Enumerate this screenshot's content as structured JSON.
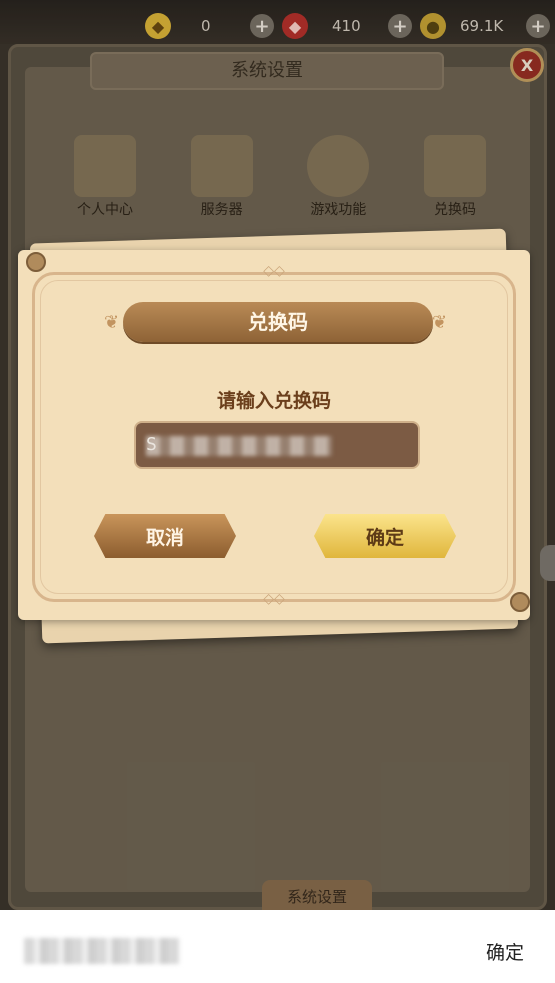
{
  "resources": [
    {
      "icon": "diamond-icon",
      "value": "0"
    },
    {
      "icon": "ruby-icon",
      "value": "410"
    },
    {
      "icon": "gold-coin-icon",
      "value": "69.1K"
    }
  ],
  "settings_panel": {
    "title": "系统设置",
    "close_label": "X",
    "menu": [
      "个人中心",
      "服务器",
      "游戏功能",
      "兑换码"
    ],
    "bottom_tab": "系统设置"
  },
  "dialog": {
    "title": "兑换码",
    "prompt": "请输入兑换码",
    "input_value": "S",
    "cancel_label": "取消",
    "confirm_label": "确定"
  },
  "system_bar": {
    "confirm_label": "确定"
  }
}
